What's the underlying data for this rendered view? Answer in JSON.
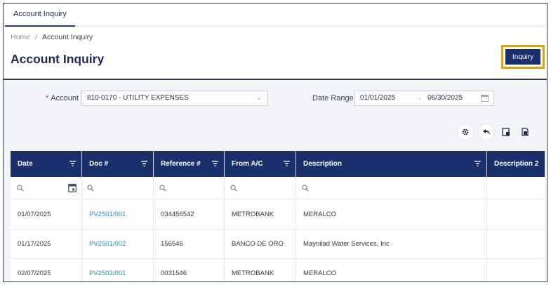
{
  "tabs": [
    {
      "label": "Account Inquiry"
    }
  ],
  "breadcrumb": {
    "home": "Home",
    "separator": "/",
    "current": "Account Inquiry"
  },
  "page_title": "Account Inquiry",
  "inquiry_button": "Inquiry",
  "filters": {
    "account_label": "Account :",
    "account_required_mark": "*",
    "account_value": "810-0170 - UTILITY EXPENSES",
    "date_range_label": "Date Range :",
    "date_from": "01/01/2025",
    "date_arrow": "→",
    "date_to": "06/30/2025"
  },
  "toolbar_icons": [
    "settings-icon",
    "undo-icon",
    "export-icon",
    "excel-icon"
  ],
  "table": {
    "columns": [
      "Date",
      "Doc #",
      "Reference #",
      "From A/C",
      "Description",
      "Description 2"
    ],
    "rows": [
      {
        "date": "01/07/2025",
        "doc": "PV2501/001",
        "ref": "034456542",
        "from": "METROBANK",
        "desc": "MERALCO",
        "desc2": ""
      },
      {
        "date": "01/17/2025",
        "doc": "PV2501/002",
        "ref": "156546",
        "from": "BANCO DE ORO",
        "desc": "Maynilad Water Services, Inc",
        "desc2": ""
      },
      {
        "date": "02/07/2025",
        "doc": "PV2502/001",
        "ref": "0031546",
        "from": "METROBANK",
        "desc": "MERALCO",
        "desc2": ""
      }
    ]
  },
  "colors": {
    "navy": "#1a2f6b",
    "highlight": "#e0a500",
    "link": "#2a8bd6"
  }
}
